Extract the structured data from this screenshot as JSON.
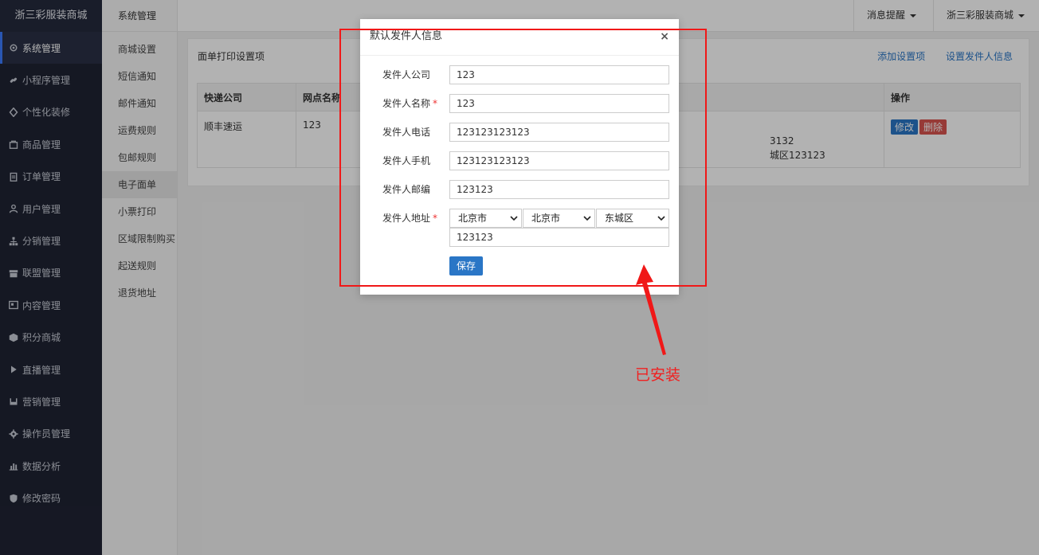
{
  "sidebar": {
    "brand": "浙三彩服装商城",
    "items": [
      {
        "label": "系统管理",
        "icon": "gear-icon"
      },
      {
        "label": "小程序管理",
        "icon": "link-icon"
      },
      {
        "label": "个性化装修",
        "icon": "diamond-icon"
      },
      {
        "label": "商品管理",
        "icon": "bag-icon"
      },
      {
        "label": "订单管理",
        "icon": "clipboard-icon"
      },
      {
        "label": "用户管理",
        "icon": "user-icon"
      },
      {
        "label": "分销管理",
        "icon": "sitemap-icon"
      },
      {
        "label": "联盟管理",
        "icon": "store-icon"
      },
      {
        "label": "内容管理",
        "icon": "newspaper-icon"
      },
      {
        "label": "积分商城",
        "icon": "cube-icon"
      },
      {
        "label": "直播管理",
        "icon": "play-icon"
      },
      {
        "label": "营销管理",
        "icon": "megaphone-icon"
      },
      {
        "label": "操作员管理",
        "icon": "cog-icon"
      },
      {
        "label": "数据分析",
        "icon": "bar-chart-icon"
      },
      {
        "label": "修改密码",
        "icon": "shield-icon"
      }
    ]
  },
  "submenu": {
    "title": "系统管理",
    "items": [
      "商城设置",
      "短信通知",
      "邮件通知",
      "运费规则",
      "包邮规则",
      "电子面单",
      "小票打印",
      "区域限制购买",
      "起送规则",
      "退货地址"
    ]
  },
  "topbar": {
    "messages": "消息提醒",
    "shop": "浙三彩服装商城"
  },
  "panel": {
    "title": "面单打印设置项",
    "add_link": "添加设置项",
    "sender_link": "设置发件人信息",
    "columns": [
      "快递公司",
      "网点名称",
      "操作"
    ],
    "row": {
      "company": "顺丰速运",
      "branch": "123",
      "partial_line1": "3132",
      "partial_line2": "城区123123",
      "edit": "修改",
      "delete": "删除"
    }
  },
  "modal": {
    "title": "默认发件人信息",
    "close": "×",
    "fields": [
      {
        "label": "发件人公司",
        "value": "123",
        "required": false
      },
      {
        "label": "发件人名称",
        "value": "123",
        "required": true
      },
      {
        "label": "发件人电话",
        "value": "123123123123",
        "required": false
      },
      {
        "label": "发件人手机",
        "value": "123123123123",
        "required": false
      },
      {
        "label": "发件人邮编",
        "value": "123123",
        "required": false
      }
    ],
    "address": {
      "label": "发件人地址",
      "province": "北京市",
      "city": "北京市",
      "district": "东城区",
      "detail": "123123"
    },
    "save": "保存"
  },
  "annotation": {
    "text": "已安装",
    "color": "#f01818"
  }
}
